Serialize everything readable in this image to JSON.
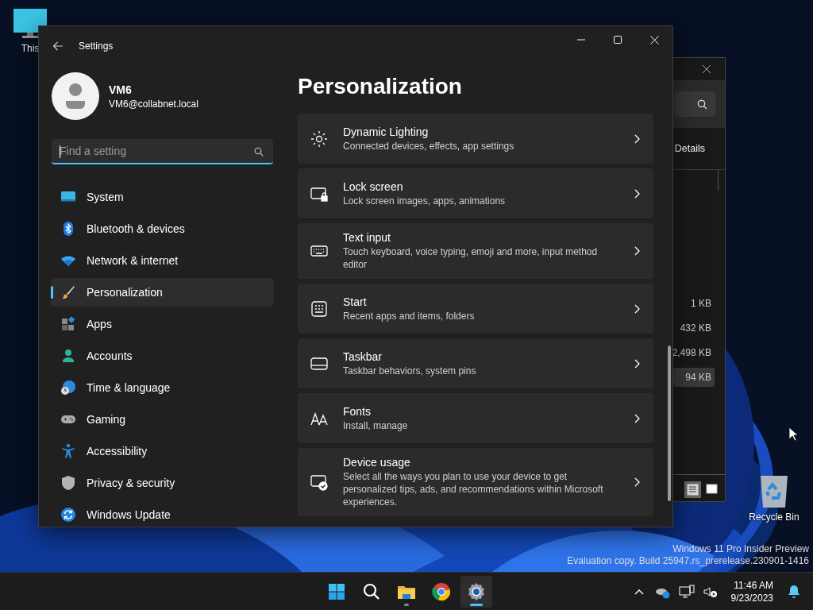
{
  "desktop_icons": [
    {
      "label": "This"
    },
    {
      "label": "Recycle Bin"
    }
  ],
  "background_window": {
    "view_label": "Details",
    "sizes": [
      {
        "text": "1 KB",
        "selected": false
      },
      {
        "text": "432 KB",
        "selected": false
      },
      {
        "text": "2,498 KB",
        "selected": false
      },
      {
        "text": "94 KB",
        "selected": true
      }
    ],
    "view_buttons": [
      {
        "selected": true
      },
      {
        "selected": false
      }
    ]
  },
  "settings_window": {
    "title": "Settings",
    "user": {
      "name": "VM6",
      "email": "VM6@collabnet.local"
    },
    "search": {
      "placeholder": "Find a setting"
    },
    "nav": [
      {
        "label": "System",
        "selected": false
      },
      {
        "label": "Bluetooth & devices",
        "selected": false
      },
      {
        "label": "Network & internet",
        "selected": false
      },
      {
        "label": "Personalization",
        "selected": true
      },
      {
        "label": "Apps",
        "selected": false
      },
      {
        "label": "Accounts",
        "selected": false
      },
      {
        "label": "Time & language",
        "selected": false
      },
      {
        "label": "Gaming",
        "selected": false
      },
      {
        "label": "Accessibility",
        "selected": false
      },
      {
        "label": "Privacy & security",
        "selected": false
      },
      {
        "label": "Windows Update",
        "selected": false
      }
    ],
    "page_title": "Personalization",
    "cards": [
      {
        "title": "Dynamic Lighting",
        "subtitle": "Connected devices, effects, app settings"
      },
      {
        "title": "Lock screen",
        "subtitle": "Lock screen images, apps, animations"
      },
      {
        "title": "Text input",
        "subtitle": "Touch keyboard, voice typing, emoji and more, input method editor"
      },
      {
        "title": "Start",
        "subtitle": "Recent apps and items, folders"
      },
      {
        "title": "Taskbar",
        "subtitle": "Taskbar behaviors, system pins"
      },
      {
        "title": "Fonts",
        "subtitle": "Install, manage"
      },
      {
        "title": "Device usage",
        "subtitle": "Select all the ways you plan to use your device to get personalized tips, ads, and recommendations within Microsoft experiences."
      }
    ]
  },
  "watermark": [
    "Windows 11 Pro Insider Preview",
    "Evaluation copy. Build 25947.rs_prerelease.230901-1416"
  ],
  "taskbar": {
    "apps": [
      {
        "open": false,
        "selected": false
      },
      {
        "open": false,
        "selected": false
      },
      {
        "open": true,
        "selected": false
      },
      {
        "open": false,
        "selected": false
      },
      {
        "open": true,
        "selected": true
      }
    ],
    "clock": {
      "time": "11:46 AM",
      "date": "9/23/2023"
    }
  }
}
